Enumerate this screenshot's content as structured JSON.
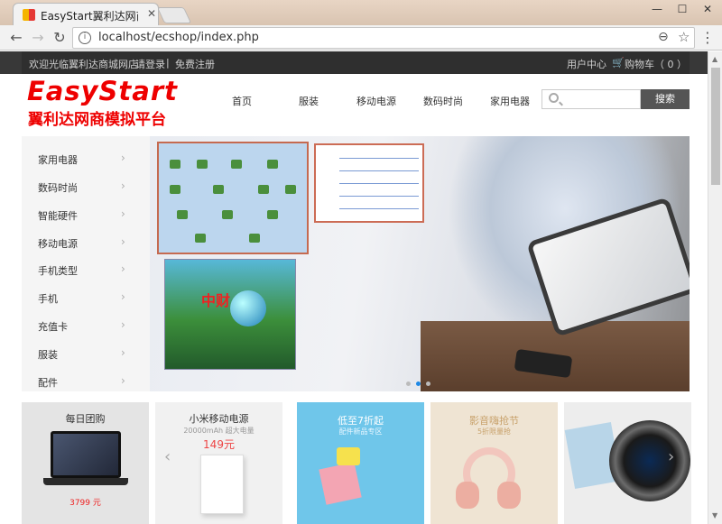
{
  "browser": {
    "tab_title": "EasyStart翼利达网商模拟",
    "url": "localhost/ecshop/index.php"
  },
  "topbar": {
    "welcome": "欢迎光临翼利达商城网店",
    "login": "请登录",
    "separator": "|",
    "register": "免费注册",
    "user_center": "用户中心",
    "cart": "购物车（ 0 ）"
  },
  "header": {
    "logo_line1": "EasyStart",
    "logo_line2": "翼利达网商模拟平台",
    "nav": [
      "首页",
      "服装",
      "移动电源",
      "数码时尚",
      "家用电器"
    ],
    "search_button": "搜索",
    "search_placeholder": ""
  },
  "categories": [
    "家用电器",
    "数码时尚",
    "智能硬件",
    "移动电源",
    "手机类型",
    "手机",
    "充值卡",
    "服装",
    "配件"
  ],
  "banner": {
    "overlay_text": "中财",
    "active_dot": 1,
    "dot_count": 3
  },
  "products": [
    {
      "title": "每日团购",
      "subtitle": "",
      "price": "3799 元"
    },
    {
      "title": "小米移动电源",
      "subtitle": "20000mAh 超大电量",
      "price": "149元"
    },
    {
      "title": "低至7折起",
      "subtitle": "配件新品专区",
      "price": ""
    },
    {
      "title": "影音嗨抢节",
      "subtitle": "5折限量抢",
      "price": ""
    },
    {
      "title": "",
      "subtitle": "",
      "price": ""
    }
  ],
  "colors": {
    "brand_red": "#ee0000",
    "topbar": "#2f2f2f",
    "search_button": "#555555"
  }
}
